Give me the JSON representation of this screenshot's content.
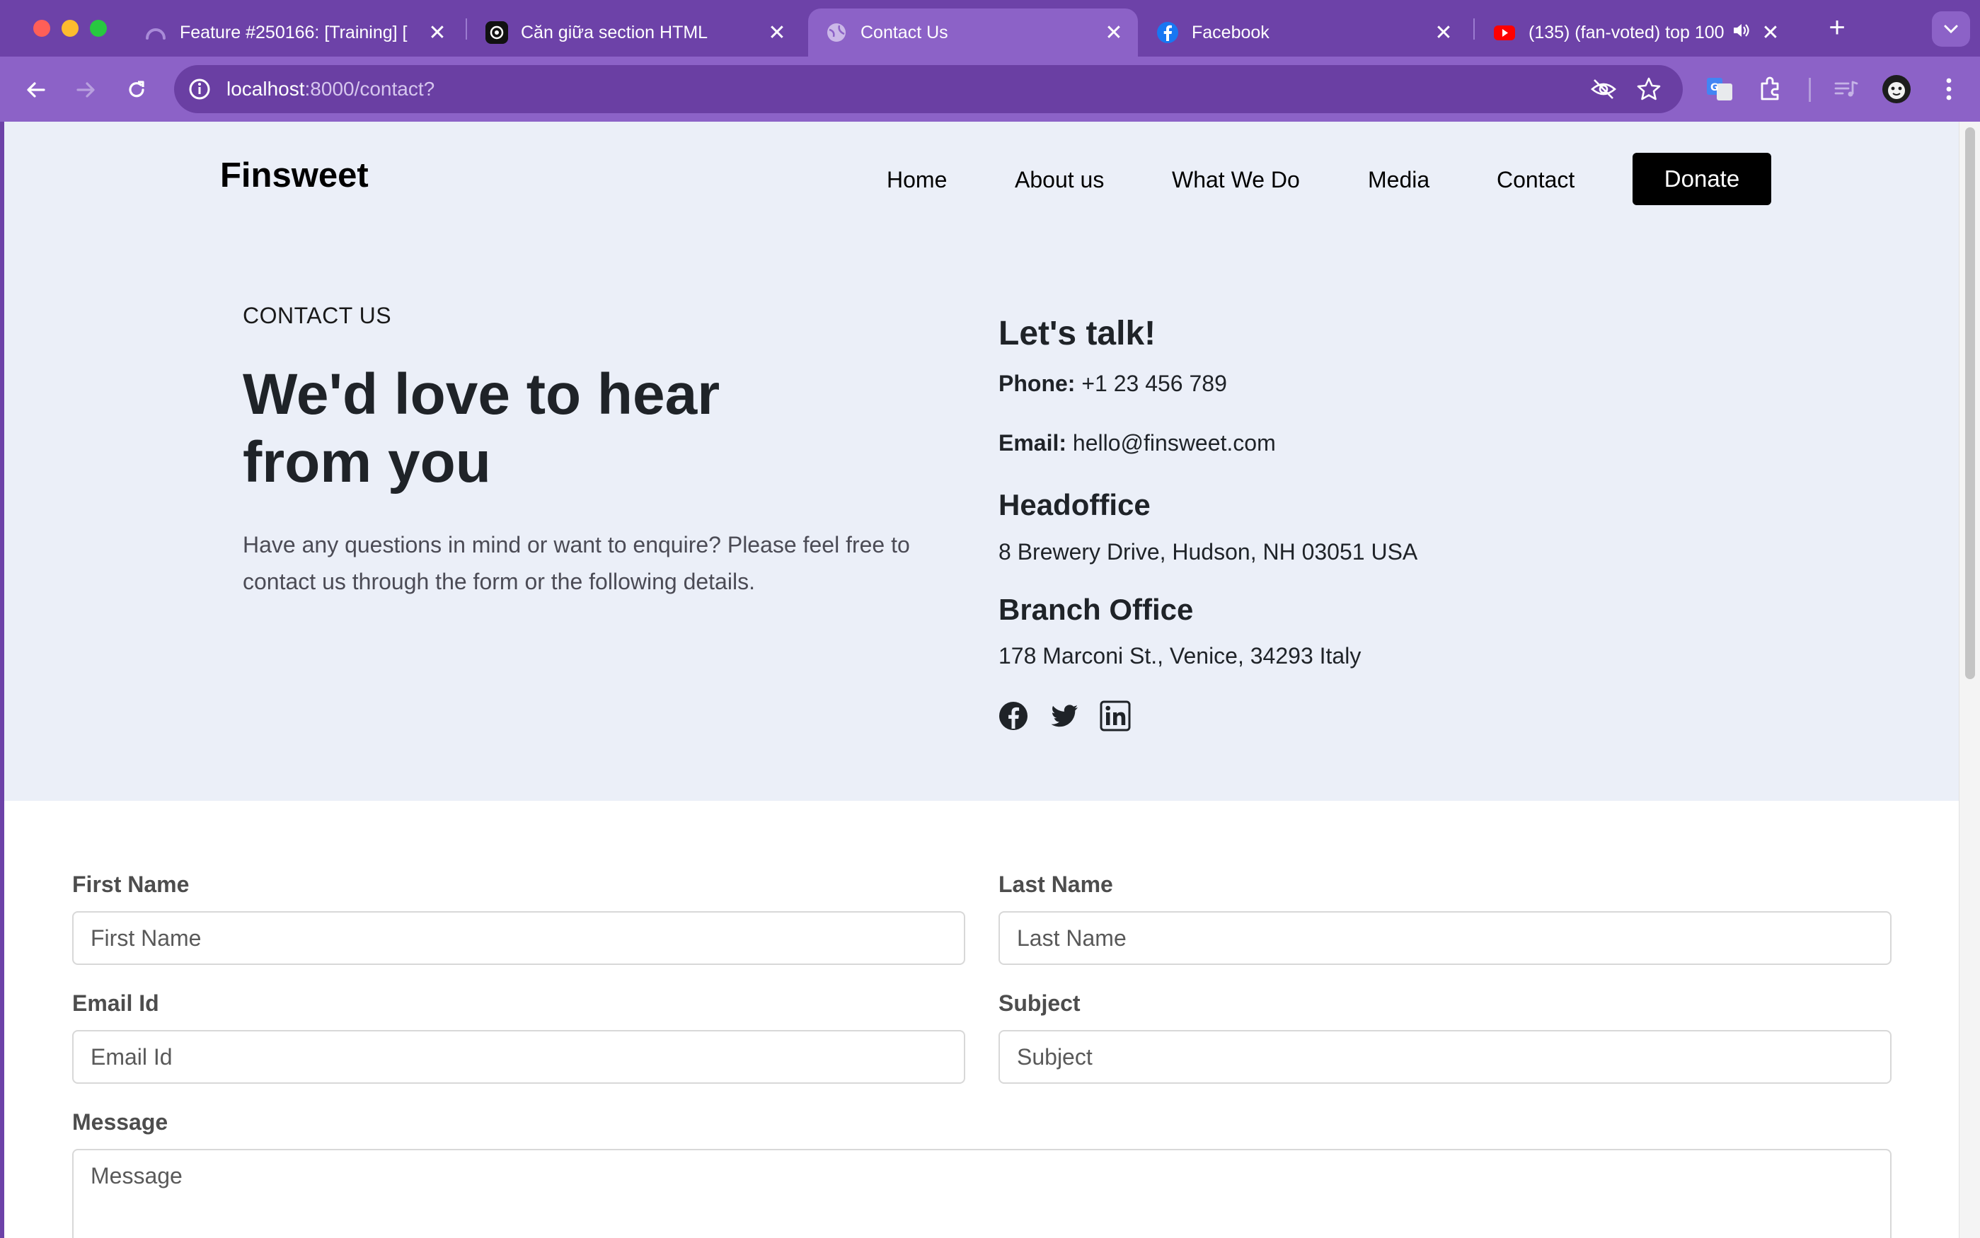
{
  "browser": {
    "tabs": [
      {
        "title": "Feature #250166: [Training] [",
        "favicon": "loading-arc-icon",
        "close": "✕"
      },
      {
        "title": "Căn giữa section HTML",
        "favicon": "openai-icon",
        "close": "✕"
      },
      {
        "title": "Contact Us",
        "favicon": "globe-icon",
        "close": "✕",
        "active": true
      },
      {
        "title": "Facebook",
        "favicon": "facebook-icon",
        "close": "✕"
      },
      {
        "title": "(135) (fan-voted) top 100",
        "favicon": "youtube-icon",
        "close": "✕",
        "audio": "speaker-icon"
      }
    ],
    "new_tab": "+",
    "address": {
      "host": "localhost",
      "rest": ":8000/contact?"
    }
  },
  "site": {
    "logo": "Finsweet",
    "nav": [
      "Home",
      "About us",
      "What We Do",
      "Media",
      "Contact"
    ],
    "donate": "Donate"
  },
  "hero": {
    "eyebrow": "CONTACT US",
    "headline": "We'd love to hear from you",
    "intro": "Have any questions in mind or want to enquire? Please feel free to contact us through the form or the following details."
  },
  "contact": {
    "title": "Let's talk!",
    "phone_label": "Phone:",
    "phone": "+1 23 456 789",
    "email_label": "Email:",
    "email": "hello@finsweet.com",
    "headoffice_title": "Headoffice",
    "headoffice_address": "8 Brewery Drive, Hudson, NH 03051 USA",
    "branch_title": "Branch Office",
    "branch_address": "178 Marconi St., Venice, 34293 Italy",
    "social": [
      "facebook-icon",
      "twitter-icon",
      "linkedin-icon"
    ]
  },
  "form": {
    "first_name": {
      "label": "First Name",
      "placeholder": "First Name"
    },
    "last_name": {
      "label": "Last Name",
      "placeholder": "Last Name"
    },
    "email": {
      "label": "Email Id",
      "placeholder": "Email Id"
    },
    "subject": {
      "label": "Subject",
      "placeholder": "Subject"
    },
    "message": {
      "label": "Message",
      "placeholder": "Message"
    }
  },
  "colors": {
    "tabbar": "#6d42a8",
    "toolbar": "#8c62c7",
    "hero_bg": "#ebeff8",
    "donate_bg": "#000000",
    "heading_text": "#1f2328"
  }
}
